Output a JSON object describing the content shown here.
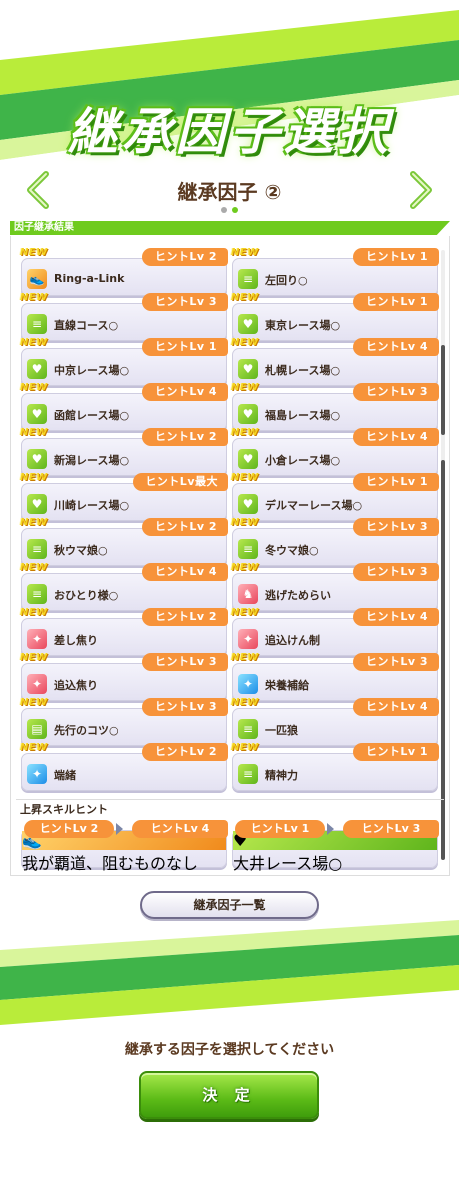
{
  "title": "継承因子選択",
  "subtitle": "継承因子 ②",
  "section_label": "因子継承結果",
  "colors": {
    "accent_green": "#6ecb1e",
    "hint_orange": "#f7933a",
    "text_brown": "#5b3a21"
  },
  "factors": [
    {
      "new": "NEW",
      "icon": "running-shoe-icon",
      "icon_color": "orange",
      "name": "Ring-a-Link",
      "hint": "ヒントLv 2"
    },
    {
      "new": "NEW",
      "icon": "road-icon",
      "icon_color": "green",
      "name": "左回り○",
      "hint": "ヒントLv 1"
    },
    {
      "new": "NEW",
      "icon": "road-icon",
      "icon_color": "green",
      "name": "直線コース○",
      "hint": "ヒントLv 3"
    },
    {
      "new": "NEW",
      "icon": "heart-icon",
      "icon_color": "green",
      "name": "東京レース場○",
      "hint": "ヒントLv 1"
    },
    {
      "new": "NEW",
      "icon": "heart-icon",
      "icon_color": "green",
      "name": "中京レース場○",
      "hint": "ヒントLv 1"
    },
    {
      "new": "NEW",
      "icon": "heart-icon",
      "icon_color": "green",
      "name": "札幌レース場○",
      "hint": "ヒントLv 4"
    },
    {
      "new": "NEW",
      "icon": "heart-icon",
      "icon_color": "green",
      "name": "函館レース場○",
      "hint": "ヒントLv 4"
    },
    {
      "new": "NEW",
      "icon": "heart-icon",
      "icon_color": "green",
      "name": "福島レース場○",
      "hint": "ヒントLv 3"
    },
    {
      "new": "NEW",
      "icon": "heart-icon",
      "icon_color": "green",
      "name": "新潟レース場○",
      "hint": "ヒントLv 2"
    },
    {
      "new": "NEW",
      "icon": "heart-icon",
      "icon_color": "green",
      "name": "小倉レース場○",
      "hint": "ヒントLv 4"
    },
    {
      "new": "NEW",
      "icon": "heart-icon",
      "icon_color": "green",
      "name": "川崎レース場○",
      "hint": "ヒントLv最大"
    },
    {
      "new": "NEW",
      "icon": "heart-icon",
      "icon_color": "green",
      "name": "デルマーレース場○",
      "hint": "ヒントLv 1"
    },
    {
      "new": "NEW",
      "icon": "road-icon",
      "icon_color": "green",
      "name": "秋ウマ娘○",
      "hint": "ヒントLv 2"
    },
    {
      "new": "NEW",
      "icon": "road-icon",
      "icon_color": "green",
      "name": "冬ウマ娘○",
      "hint": "ヒントLv 3"
    },
    {
      "new": "NEW",
      "icon": "road-icon",
      "icon_color": "green",
      "name": "おひとり様○",
      "hint": "ヒントLv 4"
    },
    {
      "new": "NEW",
      "icon": "horse-icon",
      "icon_color": "red",
      "name": "逃げためらい",
      "hint": "ヒントLv 3"
    },
    {
      "new": "NEW",
      "icon": "sparkle-icon",
      "icon_color": "red",
      "name": "差し焦り",
      "hint": "ヒントLv 2"
    },
    {
      "new": "NEW",
      "icon": "sparkle-icon",
      "icon_color": "red",
      "name": "追込けん制",
      "hint": "ヒントLv 4"
    },
    {
      "new": "NEW",
      "icon": "sparkle-icon",
      "icon_color": "red",
      "name": "追込焦り",
      "hint": "ヒントLv 3"
    },
    {
      "new": "NEW",
      "icon": "sparkle-icon",
      "icon_color": "blue",
      "name": "栄養補給",
      "hint": "ヒントLv 3"
    },
    {
      "new": "NEW",
      "icon": "book-icon",
      "icon_color": "green",
      "name": "先行のコツ○",
      "hint": "ヒントLv 3"
    },
    {
      "new": "NEW",
      "icon": "road-icon",
      "icon_color": "green",
      "name": "一匹狼",
      "hint": "ヒントLv 4"
    },
    {
      "new": "NEW",
      "icon": "sparkle-icon",
      "icon_color": "blue",
      "name": "端緒",
      "hint": "ヒントLv 2"
    },
    {
      "new": "NEW",
      "icon": "road-icon",
      "icon_color": "green",
      "name": "精神力",
      "hint": "ヒントLv 1"
    }
  ],
  "skill_hint_title": "上昇スキルヒント",
  "skill_hints": [
    {
      "icon": "running-shoe-icon",
      "icon_color": "orange",
      "name": "我が覇道、阻むものなし",
      "from": "ヒントLv 2",
      "to": "ヒントLv 4"
    },
    {
      "icon": "heart-icon",
      "icon_color": "green",
      "name": "大井レース場○",
      "from": "ヒントLv 1",
      "to": "ヒントLv 3"
    }
  ],
  "list_button": "継承因子一覧",
  "prompt": "継承する因子を選択してください",
  "decide_button": "決 定"
}
